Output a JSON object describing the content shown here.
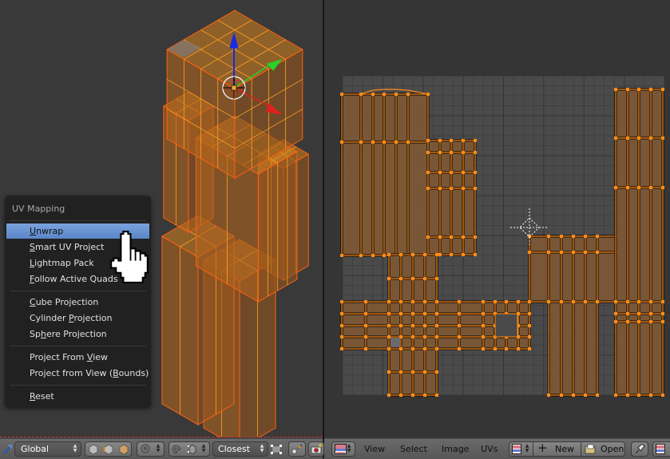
{
  "menu": {
    "title": "UV Mapping",
    "groups": [
      [
        {
          "label": "Unwrap",
          "mnemonic": "U",
          "rest": "nwrap",
          "active": true
        },
        {
          "label": "Smart UV Project",
          "mnemonic": "S",
          "rest": "mart UV Project"
        },
        {
          "label": "Lightmap Pack",
          "mnemonic": "L",
          "rest": "ightmap Pack"
        },
        {
          "label": "Follow Active Quads",
          "mnemonic": "F",
          "rest": "ollow Active Quads"
        }
      ],
      [
        {
          "label": "Cube Projection",
          "pre": "",
          "mnemonic": "C",
          "rest": "ube Projection"
        },
        {
          "label": "Cylinder Projection",
          "pre": "Cylinder ",
          "mnemonic": "P",
          "rest": "rojection"
        },
        {
          "label": "Sphere Projection",
          "pre": "Sp",
          "mnemonic": "h",
          "rest": "ere Projection"
        }
      ],
      [
        {
          "label": "Project From View",
          "pre": "Project From ",
          "mnemonic": "V",
          "rest": "iew"
        },
        {
          "label": "Project from View (Bounds)",
          "pre": "Project from View (",
          "mnemonic": "B",
          "rest": "ounds)"
        }
      ],
      [
        {
          "label": "Reset",
          "pre": "",
          "mnemonic": "R",
          "rest": "eset"
        }
      ]
    ]
  },
  "header3d": {
    "orientation": "Global",
    "snap_target": "Closest",
    "icons": [
      "manipulator-icon",
      "vertex-select-icon",
      "edge-select-icon",
      "face-select-icon",
      "proportional-edit-icon",
      "snap-magnet-icon",
      "snap-element-icon",
      "snap-target-icon",
      "snap-project-icon",
      "render-icon"
    ]
  },
  "headeruv": {
    "menus": [
      "View",
      "Select",
      "Image",
      "UVs"
    ],
    "new_label": "New",
    "open_label": "Open",
    "icons": [
      "editor-type-icon",
      "image-browse-icon",
      "new-plus-icon",
      "open-folder-icon",
      "pin-icon",
      "image-icon"
    ]
  },
  "colors": {
    "accent_orange": "#ff8c1a",
    "uv_face": "#7a5a38",
    "mesh_face": "#c87a20",
    "menu_active": "#6a94d2",
    "axis_x": "#e0201c",
    "axis_y": "#2ad02a",
    "axis_z": "#1a2ae0"
  }
}
